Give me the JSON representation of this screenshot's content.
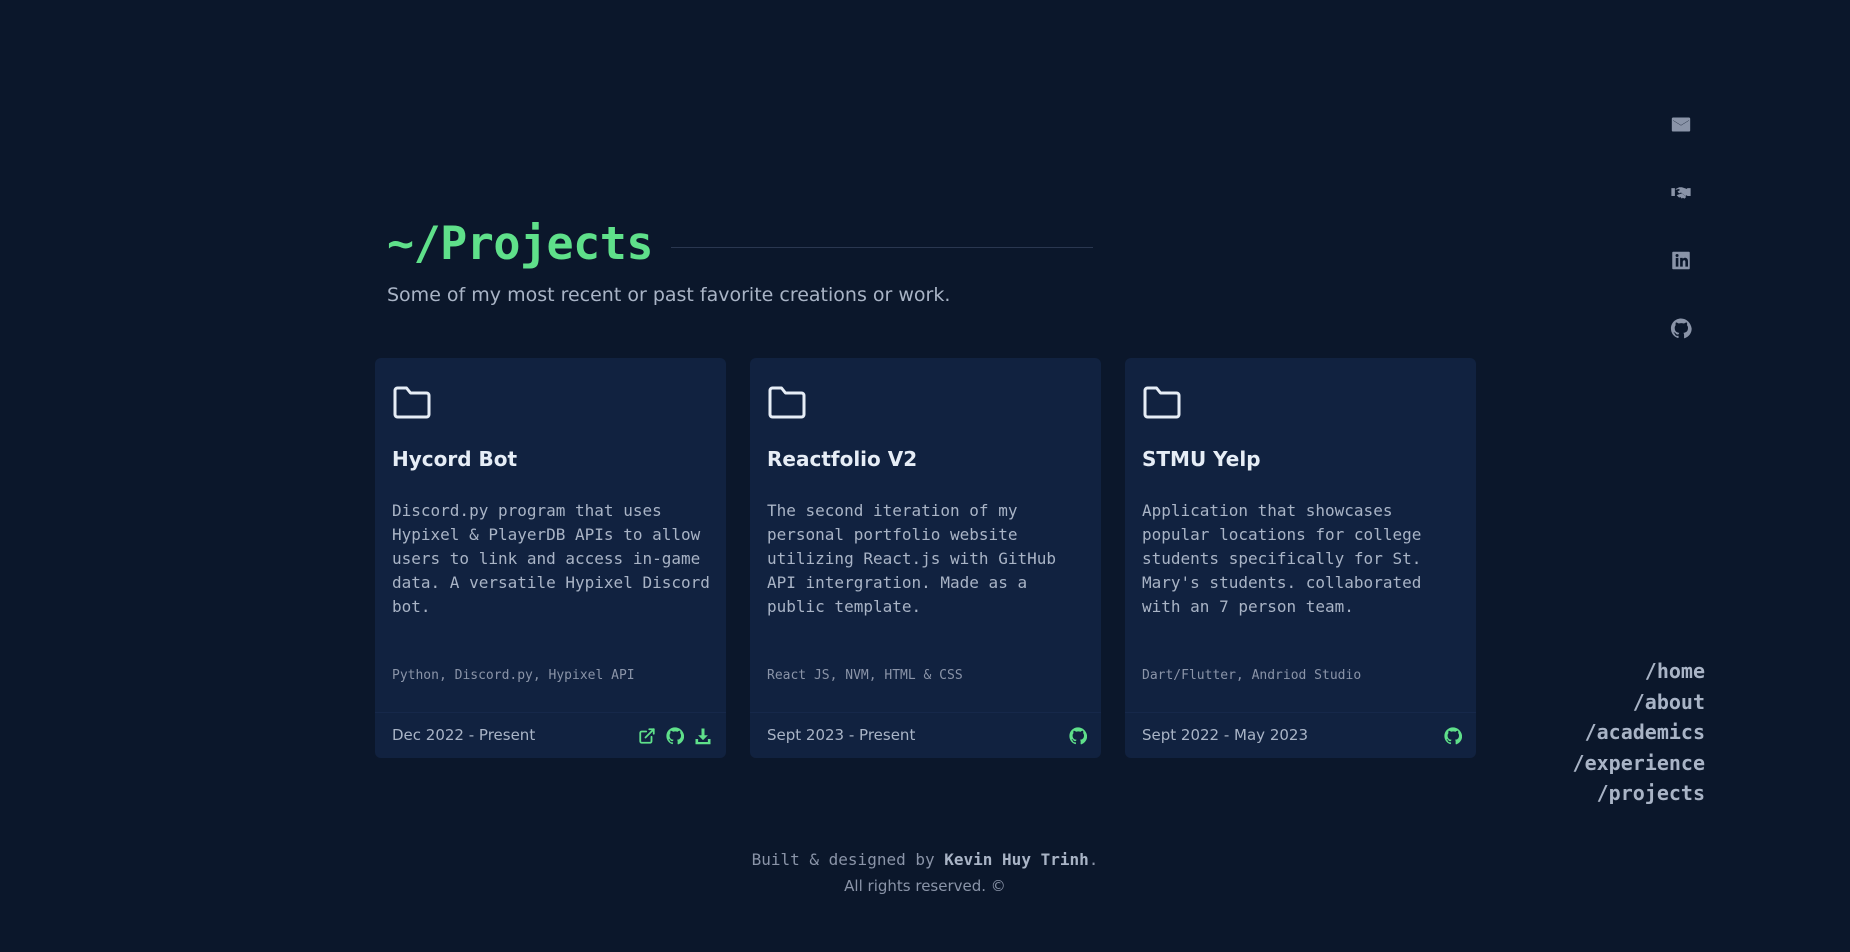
{
  "header": {
    "title": "~/Projects",
    "subtitle": "Some of my most recent or past favorite creations or work."
  },
  "projects": [
    {
      "title": "Hycord Bot",
      "description": "Discord.py program that uses Hypixel & PlayerDB APIs to allow users to link and access in-game data. A versatile Hypixel Discord bot.",
      "tech": "Python, Discord.py, Hypixel API",
      "date": "Dec 2022 - Present",
      "links": [
        "external-link-icon",
        "github-icon",
        "download-icon"
      ]
    },
    {
      "title": "Reactfolio V2",
      "description": "The second iteration of my personal portfolio website utilizing React.js with GitHub API intergration. Made as a public template.",
      "tech": "React JS, NVM, HTML & CSS",
      "date": "Sept 2023 - Present",
      "links": [
        "github-icon"
      ]
    },
    {
      "title": "STMU Yelp",
      "description": "Application that showcases popular locations for college students specifically for St. Mary's students. collaborated with an 7 person team.",
      "tech": "Dart/Flutter, Andriod Studio",
      "date": "Sept 2022 - May 2023",
      "links": [
        "github-icon"
      ]
    }
  ],
  "social": [
    "mail-icon",
    "handshake-icon",
    "linkedin-icon",
    "github-icon"
  ],
  "nav": {
    "home": "/home",
    "about": "/about",
    "academics": "/academics",
    "experience": "/experience",
    "projects": "/projects"
  },
  "footer": {
    "prefix": "Built & designed by ",
    "author": "Kevin Huy Trinh",
    "suffix": ".",
    "rights": "All rights reserved. ©"
  },
  "colors": {
    "background": "#0b172b",
    "card": "#112240",
    "accent": "#5fe08a",
    "text": "#a9b4c6",
    "heading": "#e6edf6"
  }
}
